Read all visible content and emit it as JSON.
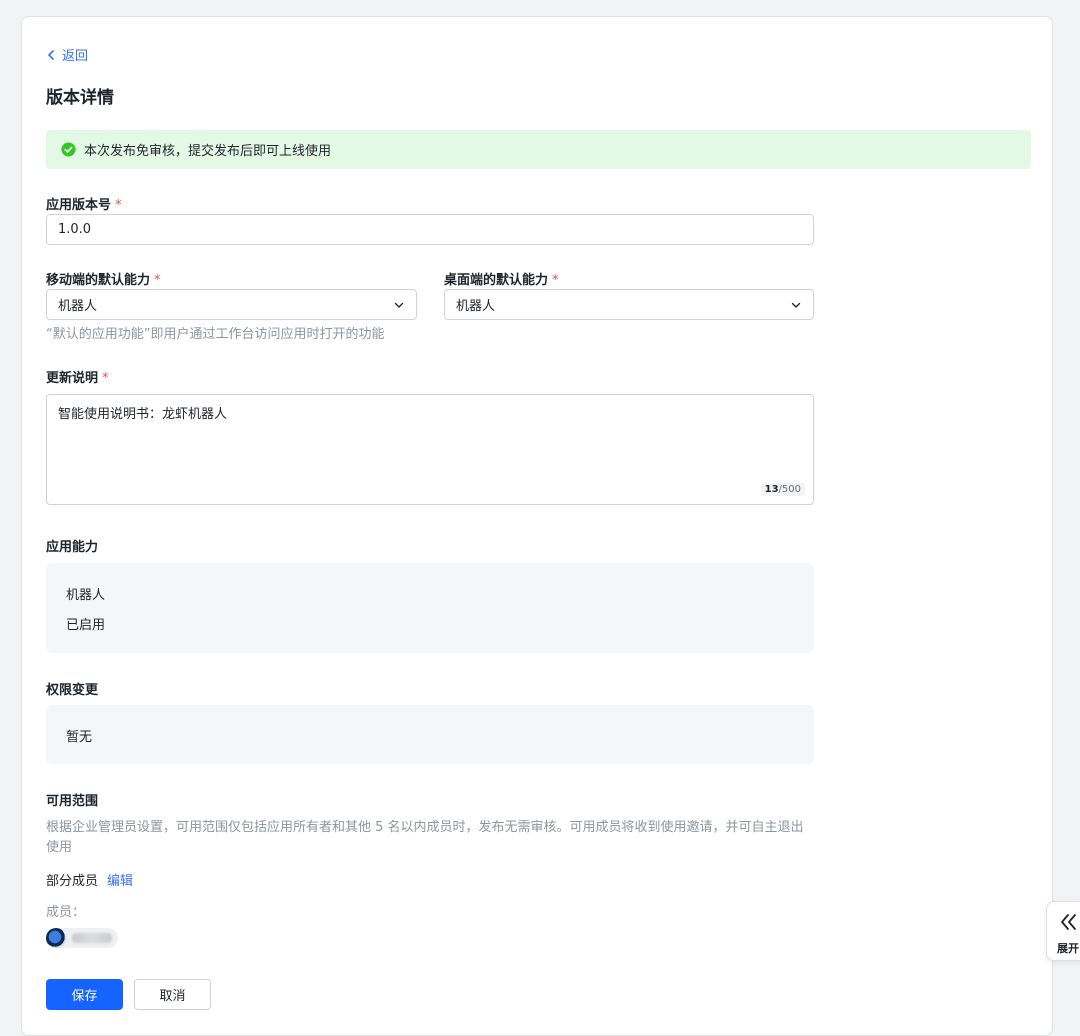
{
  "nav": {
    "back_label": "返回"
  },
  "page": {
    "title": "版本详情"
  },
  "alert": {
    "text": "本次发布免审核，提交发布后即可上线使用"
  },
  "version": {
    "label": "应用版本号",
    "required": "*",
    "value": "1.0.0"
  },
  "mobile_default": {
    "label": "移动端的默认能力",
    "required": "*",
    "value": "机器人"
  },
  "desktop_default": {
    "label": "桌面端的默认能力",
    "required": "*",
    "value": "机器人"
  },
  "default_hint": "“默认的应用功能”即用户通过工作台访问应用时打开的功能",
  "update_notes": {
    "label": "更新说明",
    "required": "*",
    "value": "智能使用说明书：龙虾机器人",
    "count": "13",
    "max": "/500"
  },
  "capabilities": {
    "label": "应用能力",
    "name": "机器人",
    "status": "已启用"
  },
  "permissions": {
    "label": "权限变更",
    "value": "暂无"
  },
  "scope": {
    "label": "可用范围",
    "description": "根据企业管理员设置，可用范围仅包括应用所有者和其他 5 名以内成员时，发布无需审核。可用成员将收到使用邀请，并可自主退出使用",
    "type": "部分成员",
    "edit_label": "编辑",
    "members_label": "成员："
  },
  "actions": {
    "save_label": "保存",
    "cancel_label": "取消"
  },
  "side_panel": {
    "expand_label": "展开"
  },
  "colors": {
    "primary": "#1664ff",
    "link": "#3370ff",
    "success_bg": "#e4f8e6",
    "success_icon": "#34c724",
    "required": "#f54a45"
  },
  "icons": {
    "back": "chevron-left-icon",
    "alert": "check-circle-icon",
    "select": "chevron-down-icon",
    "expand": "double-chevron-left-icon"
  }
}
